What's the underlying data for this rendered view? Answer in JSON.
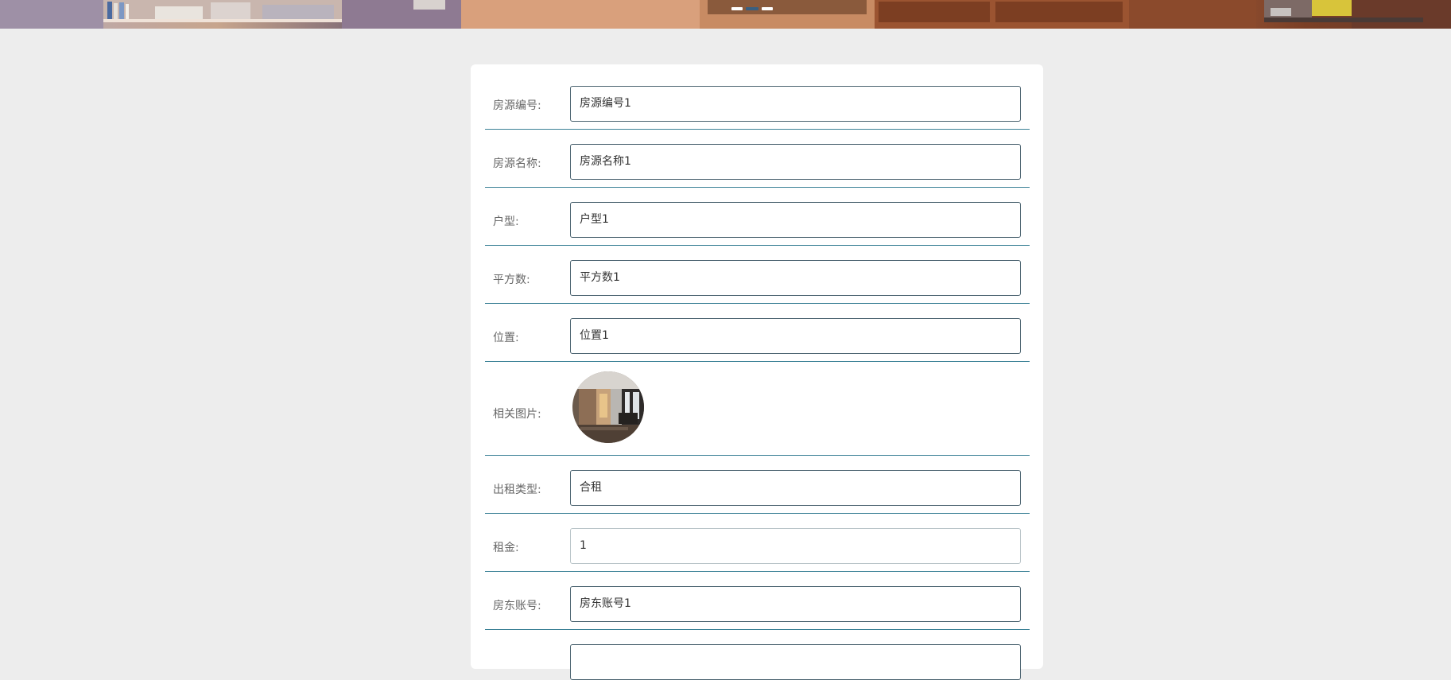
{
  "banner": {
    "slides": 3,
    "active_slide": 2
  },
  "form": {
    "fields": [
      {
        "label": "房源编号:",
        "value": "房源编号1"
      },
      {
        "label": "房源名称:",
        "value": "房源名称1"
      },
      {
        "label": "户型:",
        "value": "户型1"
      },
      {
        "label": "平方数:",
        "value": "平方数1"
      },
      {
        "label": "位置:",
        "value": "位置1"
      },
      {
        "label": "相关图片:"
      },
      {
        "label": "出租类型:",
        "value": "合租"
      },
      {
        "label": "租金:",
        "value": "1"
      },
      {
        "label": "房东账号:",
        "value": "房东账号1"
      }
    ]
  },
  "colors": {
    "page_background": "#ededed",
    "card_background": "#ffffff",
    "row_divider": "#3b8196",
    "field_border": "#4b6370",
    "label_text": "#666666"
  }
}
